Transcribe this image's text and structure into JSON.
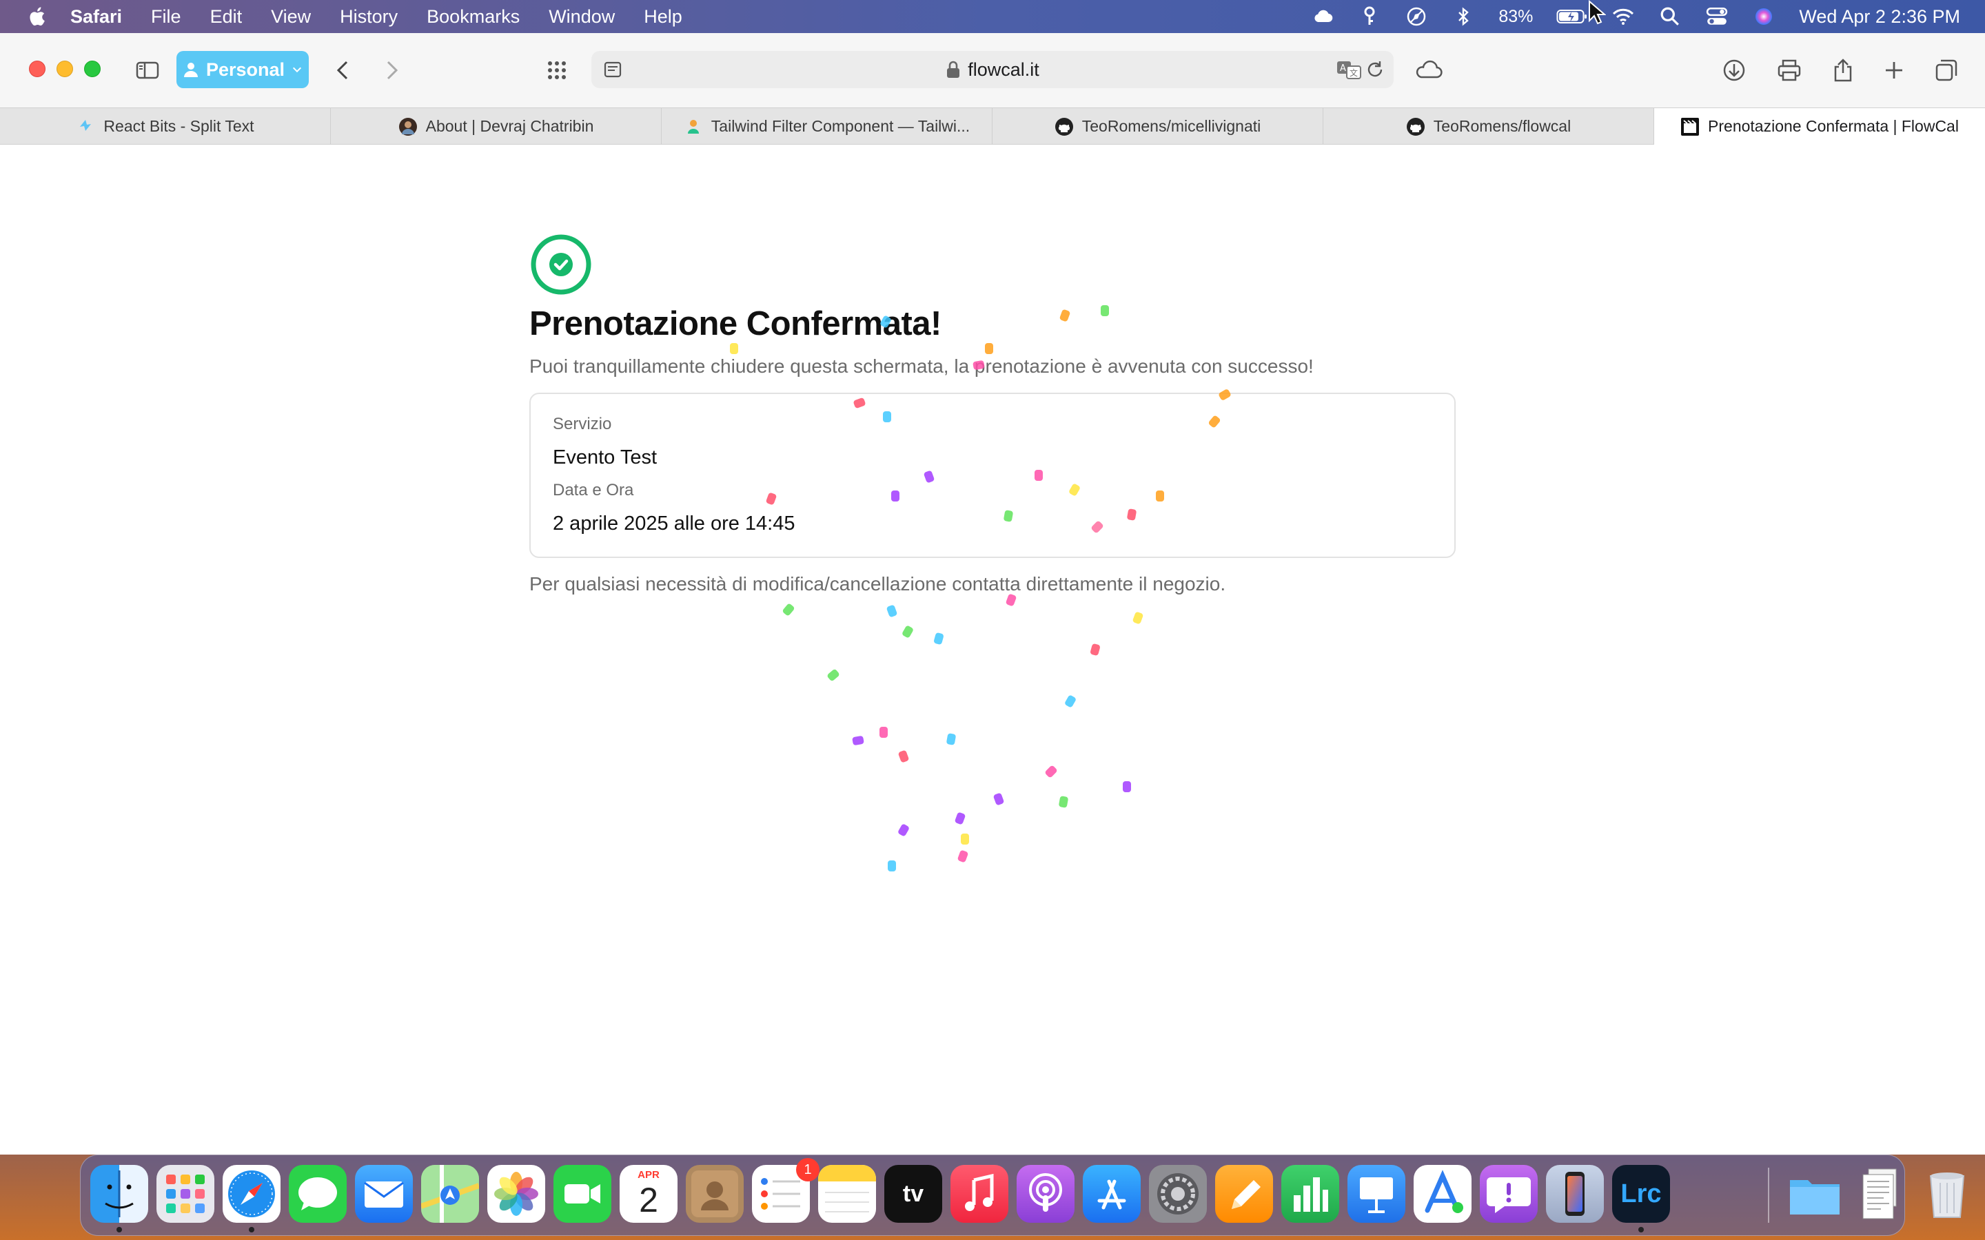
{
  "menubar": {
    "app_name": "Safari",
    "menus": [
      "File",
      "Edit",
      "View",
      "History",
      "Bookmarks",
      "Window",
      "Help"
    ],
    "battery_percent": "83%",
    "clock": "Wed Apr 2  2:36 PM"
  },
  "toolbar": {
    "profile_label": "Personal",
    "url": "flowcal.it"
  },
  "tabs": [
    {
      "title": "React Bits - Split Text",
      "icon": "react-bits-icon"
    },
    {
      "title": "About | Devraj Chatribin",
      "icon": "avatar-icon"
    },
    {
      "title": "Tailwind Filter Component — Tailwi...",
      "icon": "tailwind-icon"
    },
    {
      "title": "TeoRomens/micellivignati",
      "icon": "github-icon"
    },
    {
      "title": "TeoRomens/flowcal",
      "icon": "github-icon"
    },
    {
      "title": "Prenotazione Confermata | FlowCal",
      "icon": "flowcal-icon",
      "active": true
    }
  ],
  "page": {
    "title": "Prenotazione Confermata!",
    "subtitle": "Puoi tranquillamente chiudere questa schermata, la prenotazione è avvenuta con successo!",
    "service_label": "Servizio",
    "service_value": "Evento Test",
    "datetime_label": "Data e Ora",
    "datetime_value": "2 aprile 2025 alle ore 14:45",
    "note": "Per qualsiasi necessità di modifica/cancellazione contatta direttamente il negozio."
  },
  "dock": {
    "calendar_month": "APR",
    "calendar_day": "2",
    "reminders_badge": "1",
    "tv_label": "tv",
    "lrc_label": "Lrc"
  },
  "colors": {
    "success_green": "#16b86a",
    "profile_blue": "#5ac8f5"
  }
}
